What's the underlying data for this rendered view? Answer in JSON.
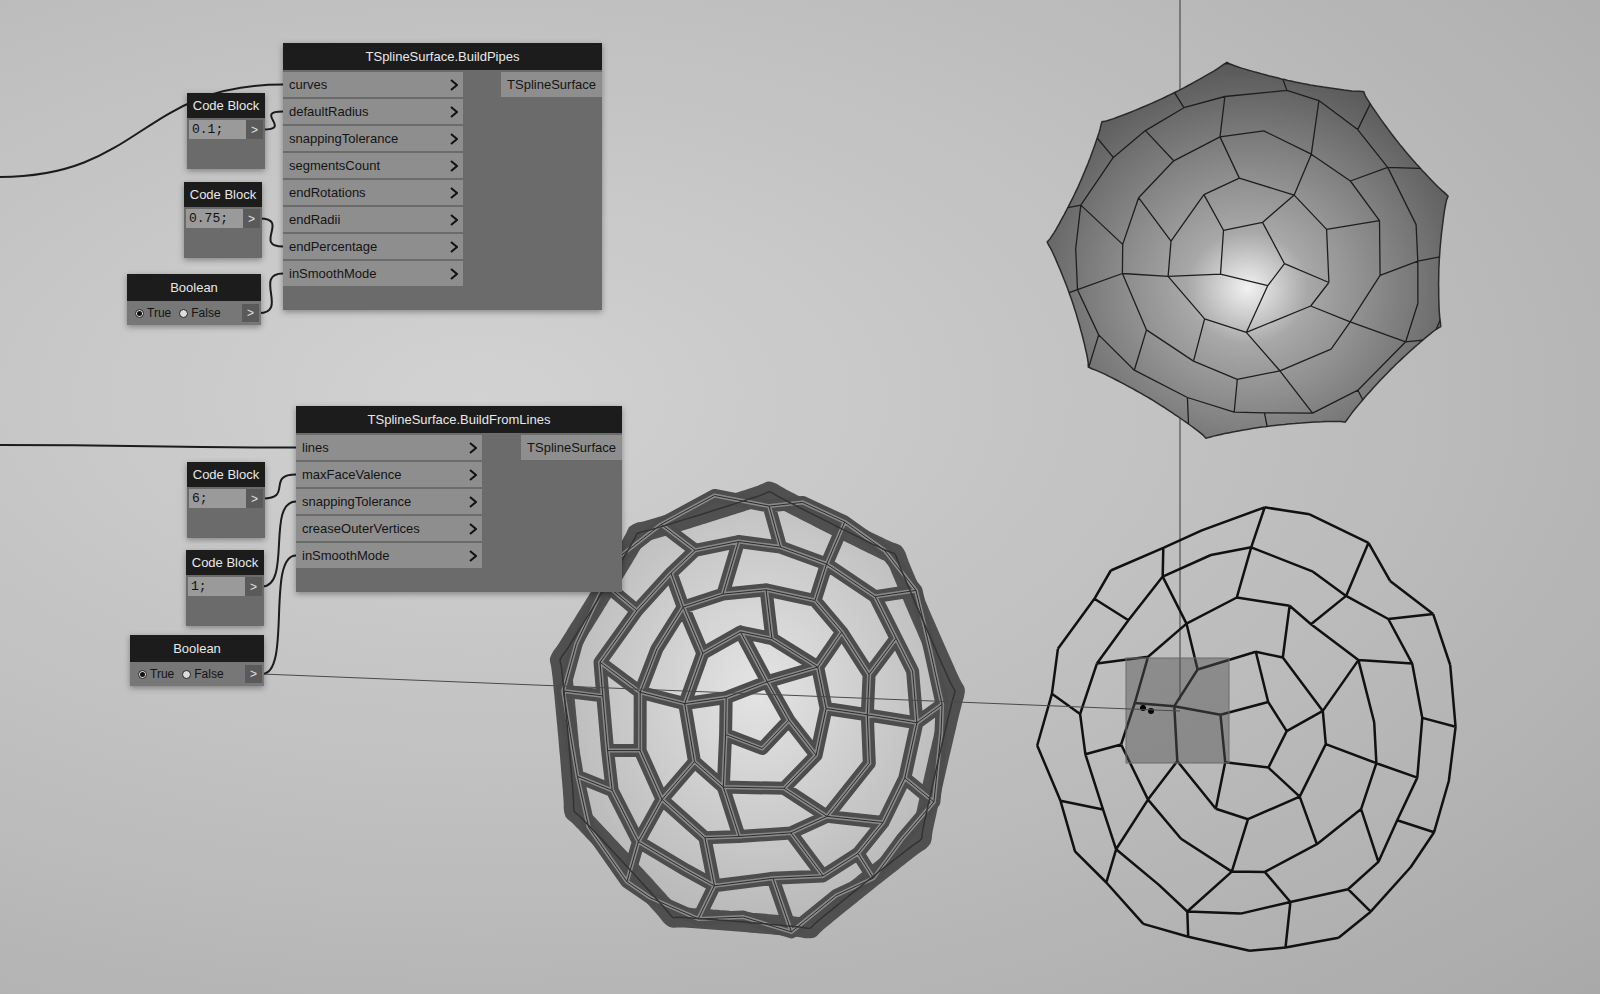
{
  "nodes": [
    {
      "title": "TSplineSurface.BuildPipes",
      "inputs": [
        "curves",
        "defaultRadius",
        "snappingTolerance",
        "segmentsCount",
        "endRotations",
        "endRadii",
        "endPercentage",
        "inSmoothMode"
      ],
      "output": "TSplineSurface"
    },
    {
      "title": "TSplineSurface.BuildFromLines",
      "inputs": [
        "lines",
        "maxFaceValence",
        "snappingTolerance",
        "creaseOuterVertices",
        "inSmoothMode"
      ],
      "output": "TSplineSurface"
    }
  ],
  "code_blocks": [
    {
      "title": "Code Block",
      "value": "0.1;",
      "port": ">"
    },
    {
      "title": "Code Block",
      "value": "0.75;",
      "port": ">"
    },
    {
      "title": "Code Block",
      "value": "6;",
      "port": ">"
    },
    {
      "title": "Code Block",
      "value": "1;",
      "port": ">"
    }
  ],
  "booleans": [
    {
      "title": "Boolean",
      "options": [
        {
          "label": "True",
          "selected": true
        },
        {
          "label": "False",
          "selected": false
        }
      ],
      "port": ">"
    },
    {
      "title": "Boolean",
      "options": [
        {
          "label": "True",
          "selected": true
        },
        {
          "label": "False",
          "selected": false
        }
      ],
      "port": ">"
    }
  ]
}
